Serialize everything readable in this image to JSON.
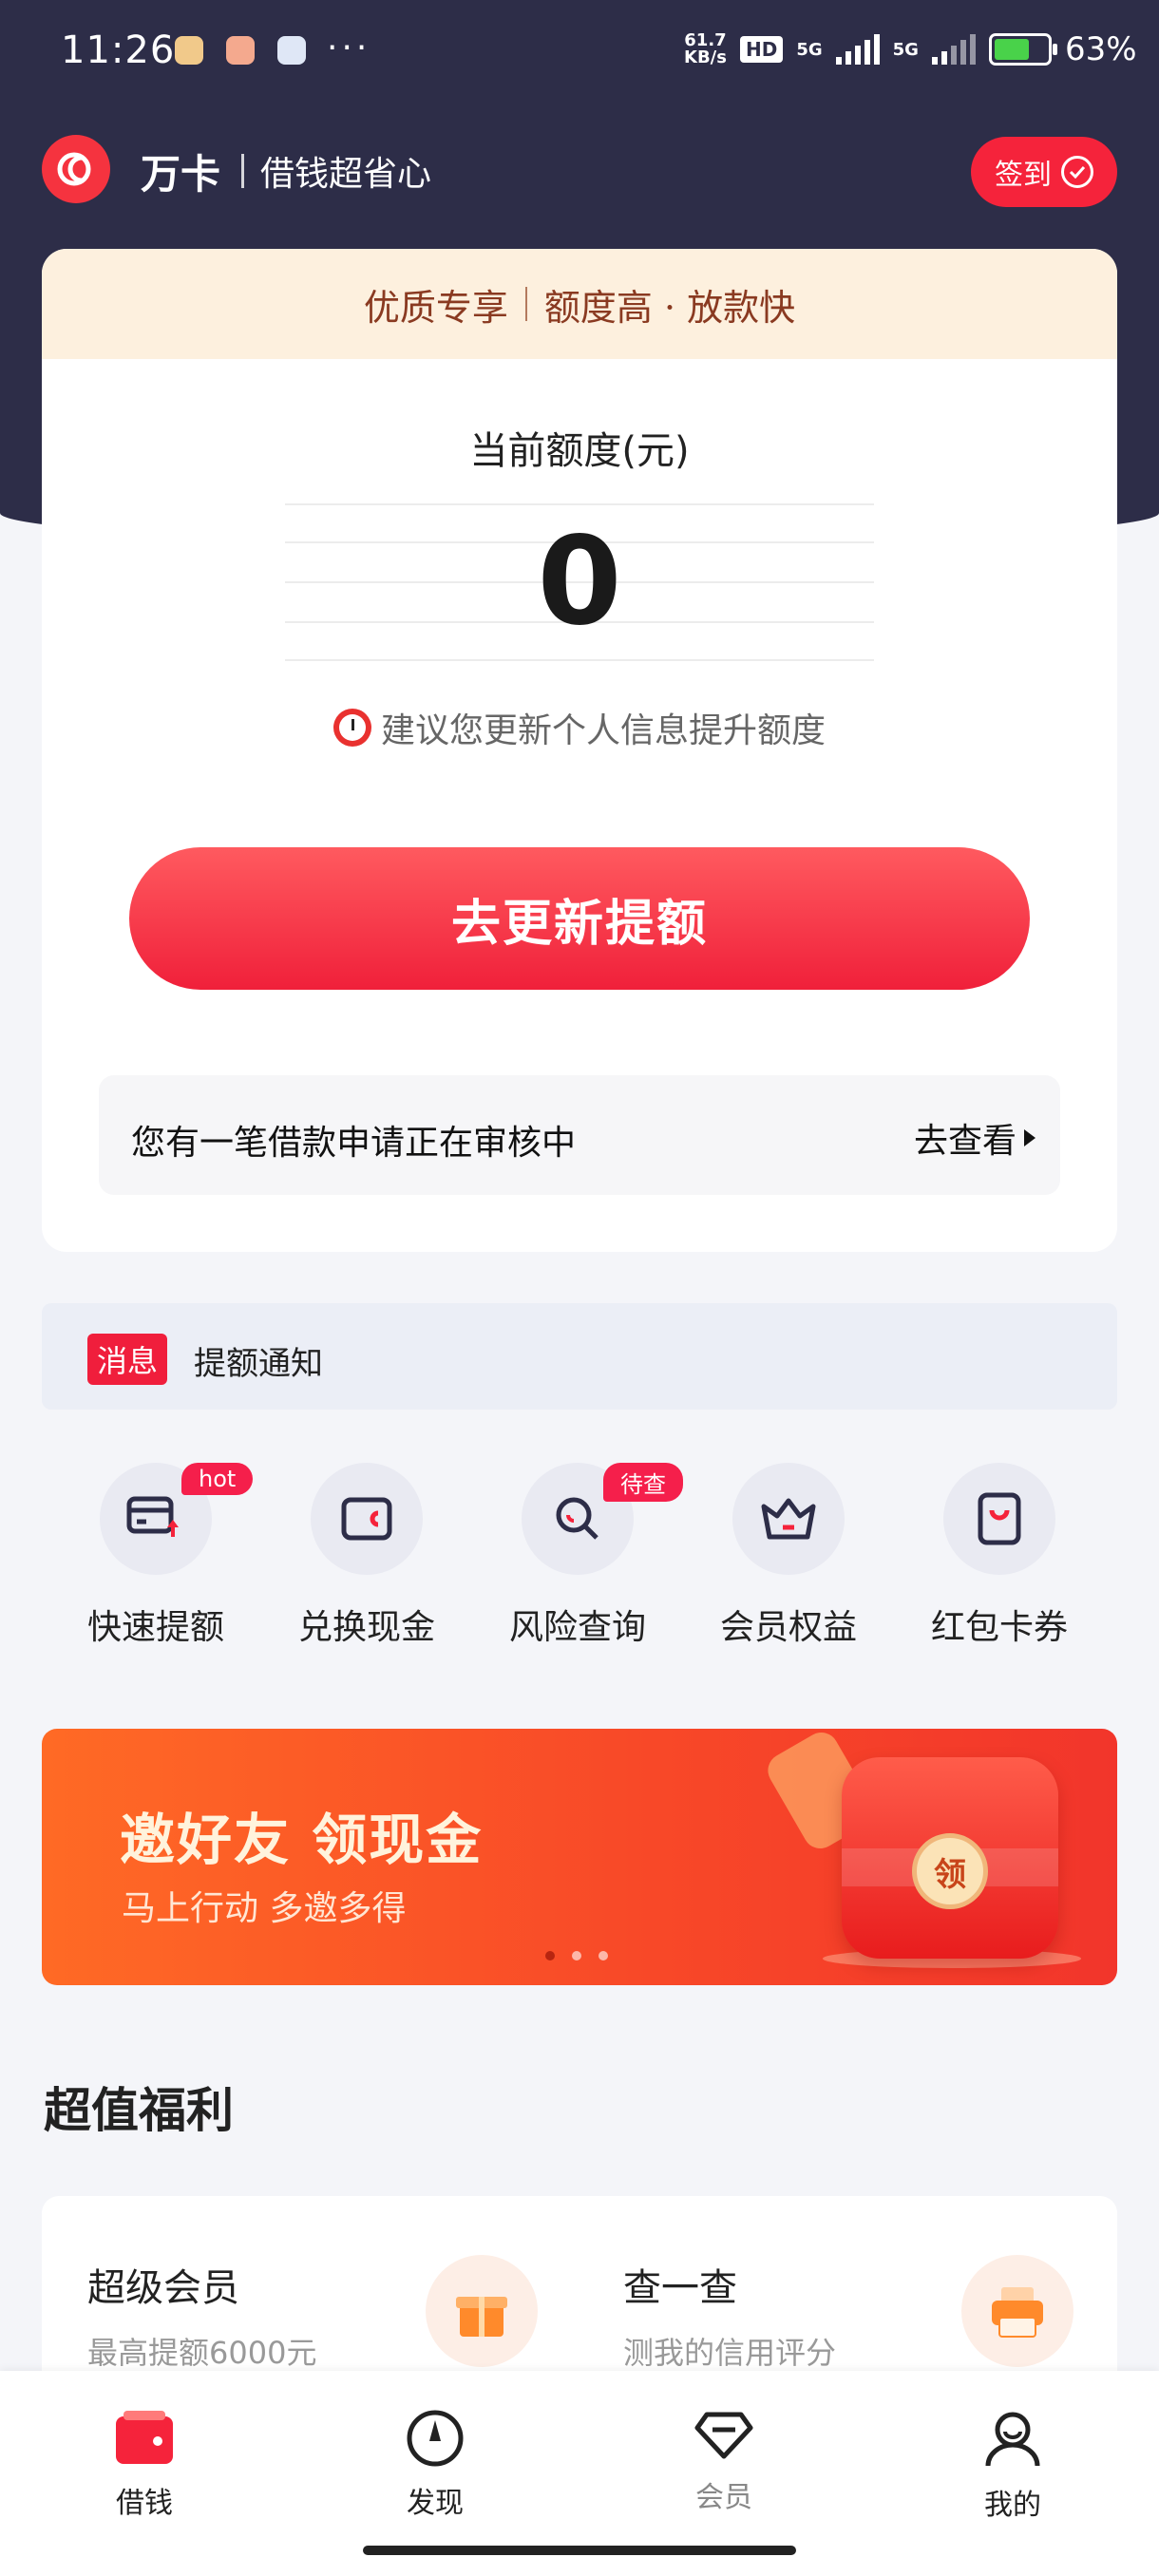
{
  "status_bar": {
    "time": "11:26",
    "dots": "···",
    "net_speed_top": "61.7",
    "net_speed_bottom": "KB/s",
    "hd": "HD",
    "sim1": "5G",
    "sim2": "5G",
    "battery": "63%"
  },
  "header": {
    "brand": "万卡",
    "slogan": "借钱超省心",
    "signin_label": "签到"
  },
  "credit_card": {
    "promo_left": "优质专享",
    "promo_right": "额度高 · 放款快",
    "limit_label": "当前额度(元)",
    "limit_value": "0",
    "tip": "建议您更新个人信息提升额度",
    "cta_label": "去更新提额",
    "notice_text": "您有一笔借款申请正在审核中",
    "notice_link": "去查看"
  },
  "message": {
    "tag": "消息",
    "text": "提额通知"
  },
  "quick_actions": [
    {
      "label": "快速提额",
      "badge": "hot"
    },
    {
      "label": "兑换现金",
      "badge": ""
    },
    {
      "label": "风险查询",
      "badge": "待查"
    },
    {
      "label": "会员权益",
      "badge": ""
    },
    {
      "label": "红包卡券",
      "badge": ""
    }
  ],
  "banner": {
    "title": "邀好友 领现金",
    "subtitle": "马上行动 多邀多得",
    "coin_text": "领"
  },
  "welfare": {
    "title": "超值福利",
    "items": [
      {
        "title": "超级会员",
        "subtitle": "最高提额6000元"
      },
      {
        "title": "查一查",
        "subtitle": "测我的信用评分"
      }
    ]
  },
  "tabs": [
    {
      "label": "借钱"
    },
    {
      "label": "发现"
    },
    {
      "label": "会员"
    },
    {
      "label": "我的"
    }
  ],
  "colors": {
    "header_bg": "#2d2d48",
    "accent_red": "#f5233b",
    "banner_orange": "#f84928"
  }
}
